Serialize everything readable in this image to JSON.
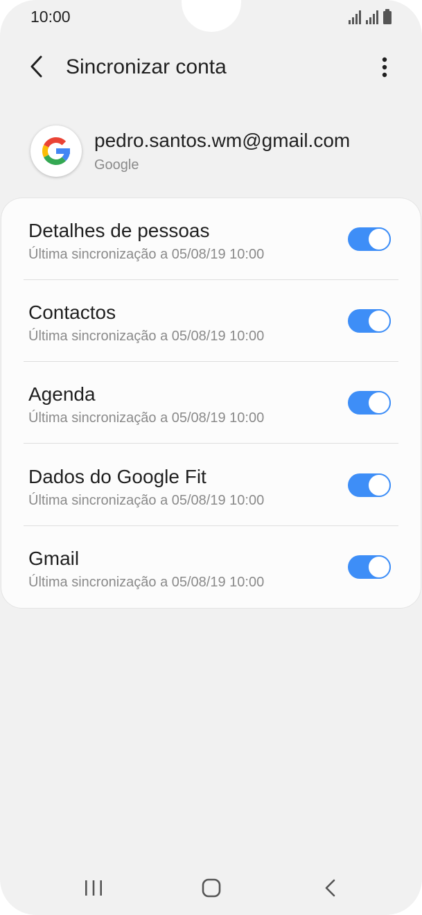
{
  "status_bar": {
    "time": "10:00",
    "icons": [
      "signal-icon",
      "signal-icon",
      "battery-icon"
    ]
  },
  "app_bar": {
    "back_icon": "back-arrow-icon",
    "title": "Sincronizar conta",
    "more_icon": "more-vert-icon"
  },
  "account": {
    "logo_icon": "google-logo-icon",
    "email": "pedro.santos.wm@gmail.com",
    "type": "Google"
  },
  "sync_items": [
    {
      "title": "Detalhes de pessoas",
      "subtitle": "Última sincronização a 05/08/19  10:00",
      "enabled": true
    },
    {
      "title": "Contactos",
      "subtitle": "Última sincronização a 05/08/19  10:00",
      "enabled": true
    },
    {
      "title": "Agenda",
      "subtitle": "Última sincronização a 05/08/19  10:00",
      "enabled": true
    },
    {
      "title": "Dados do Google Fit",
      "subtitle": "Última sincronização a 05/08/19  10:00",
      "enabled": true
    },
    {
      "title": "Gmail",
      "subtitle": "Última sincronização a 05/08/19  10:00",
      "enabled": true
    }
  ],
  "nav_bar": {
    "icons": [
      "recent-apps-icon",
      "home-icon",
      "back-icon"
    ]
  },
  "colors": {
    "accent": "#3e8ef7",
    "background": "#f1f1f1",
    "card": "#fcfcfc"
  }
}
